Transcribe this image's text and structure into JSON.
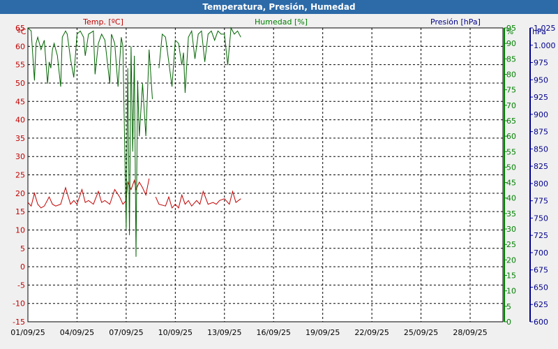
{
  "window": {
    "title": "Temperatura, Presión, Humedad"
  },
  "chart_data": {
    "type": "line",
    "title": "Temperatura, Presión, Humedad",
    "grid": true,
    "x_range": [
      "01/09/25",
      "30/09/25"
    ],
    "x_ticks": [
      "01/09/25",
      "04/09/25",
      "07/09/25",
      "10/09/25",
      "13/09/25",
      "16/09/25",
      "19/09/25",
      "22/09/25",
      "25/09/25",
      "28/09/25"
    ],
    "axes": {
      "temperature": {
        "label": "Temp. [ºC]",
        "unit": "ºC",
        "min": -15,
        "max": 65,
        "ticks": [
          "-15",
          "-10",
          "-5",
          "0",
          "5",
          "10",
          "15",
          "20",
          "25",
          "30",
          "35",
          "40",
          "45",
          "50",
          "55",
          "60",
          "65"
        ]
      },
      "humidity": {
        "label": "Humedad [%]",
        "unit": "%",
        "min": 0,
        "max": 95,
        "ticks": [
          "0",
          "5",
          "10",
          "15",
          "20",
          "25",
          "30",
          "35",
          "40",
          "45",
          "50",
          "55",
          "60",
          "65",
          "70",
          "75",
          "80",
          "85",
          "90",
          "95"
        ]
      },
      "pressure": {
        "label": "Presión [hPa]",
        "unit": "hPa",
        "min": 600,
        "max": 1025,
        "ticks": [
          "600",
          "625",
          "650",
          "675",
          "700",
          "725",
          "750",
          "775",
          "800",
          "825",
          "850",
          "875",
          "900",
          "925",
          "950",
          "975",
          "1.000",
          "1.025"
        ]
      }
    },
    "series": [
      {
        "name": "Temp. [ºC]",
        "axis": "temperature",
        "color": "#c00000",
        "x": [
          1.0,
          1.2,
          1.4,
          1.6,
          1.8,
          2.0,
          2.3,
          2.5,
          2.7,
          3.0,
          3.3,
          3.6,
          3.8,
          4.0,
          4.3,
          4.5,
          4.7,
          5.0,
          5.3,
          5.5,
          5.7,
          6.0,
          6.3,
          6.6,
          6.8,
          7.0,
          7.1,
          7.3,
          7.5,
          7.6,
          7.8,
          8.0,
          8.2,
          8.4,
          8.6,
          8.8,
          9.0,
          9.4,
          9.6,
          9.8,
          10.0,
          10.2,
          10.4,
          10.6,
          10.8,
          11.0,
          11.3,
          11.5,
          11.7,
          12.0,
          12.3,
          12.5,
          12.7,
          13.0,
          13.3,
          13.5,
          13.7,
          14.0
        ],
        "values": [
          17.5,
          16.5,
          20,
          17,
          16,
          16.5,
          19,
          17,
          16.5,
          17,
          21.5,
          17,
          18,
          17,
          21,
          17.5,
          18,
          17,
          20.5,
          17.5,
          18,
          17,
          21,
          19,
          17,
          18,
          23,
          21,
          23.5,
          21,
          23,
          21.5,
          19.5,
          24,
          null,
          19,
          17,
          16.5,
          19,
          16,
          17,
          16,
          19.5,
          17,
          18,
          16.5,
          18,
          17,
          20.5,
          17,
          17.5,
          17,
          18,
          18.5,
          17,
          20.5,
          17.5,
          18.5
        ]
      },
      {
        "name": "Humedad [%]",
        "axis": "humidity",
        "color": "#006400",
        "x": [
          1.0,
          1.2,
          1.4,
          1.5,
          1.6,
          1.8,
          2.0,
          2.2,
          2.3,
          2.4,
          2.5,
          2.6,
          2.8,
          3.0,
          3.1,
          3.3,
          3.4,
          3.6,
          3.8,
          4.0,
          4.2,
          4.4,
          4.5,
          4.7,
          5.0,
          5.1,
          5.3,
          5.5,
          5.7,
          6.0,
          6.1,
          6.3,
          6.5,
          6.7,
          6.8,
          7.0,
          7.1,
          7.2,
          7.3,
          7.4,
          7.5,
          7.6,
          7.7,
          7.8,
          8.0,
          8.2,
          8.4,
          8.6,
          8.8,
          9.0,
          9.2,
          9.4,
          9.6,
          9.8,
          10.0,
          10.2,
          10.4,
          10.5,
          10.6,
          10.8,
          11.0,
          11.2,
          11.4,
          11.6,
          11.8,
          12.0,
          12.2,
          12.4,
          12.6,
          12.8,
          13.0,
          13.2,
          13.4,
          13.6,
          13.8,
          14.0
        ],
        "values": [
          95,
          94,
          78,
          90,
          92,
          88,
          91,
          77,
          84,
          82,
          88,
          90,
          86,
          76,
          92,
          94,
          93,
          85,
          79,
          93,
          94,
          92,
          86,
          93,
          94,
          80,
          90,
          93,
          91,
          77,
          93,
          90,
          76,
          92,
          89,
          30,
          82,
          28,
          89,
          55,
          86,
          21,
          78,
          60,
          77,
          60,
          88,
          72,
          null,
          82,
          93,
          92,
          84,
          76,
          91,
          90,
          83,
          87,
          74,
          92,
          94,
          85,
          93,
          94,
          84,
          93,
          94,
          91,
          94,
          93,
          93,
          83,
          95,
          93,
          94,
          92
        ]
      },
      {
        "name": "Presión [hPa]",
        "axis": "pressure",
        "color": "#00008b",
        "x": [],
        "values": []
      }
    ]
  }
}
